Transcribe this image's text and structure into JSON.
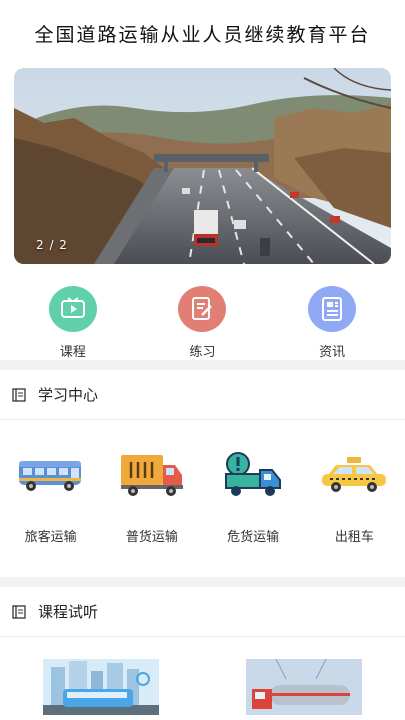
{
  "header": {
    "title": "全国道路运输从业人员继续教育平台"
  },
  "banner": {
    "counter": "2 / 2"
  },
  "quick_nav": [
    {
      "label": "课程",
      "icon": "tv-play-icon",
      "color": "#5fd0a7"
    },
    {
      "label": "练习",
      "icon": "edit-note-icon",
      "color": "#e27f74"
    },
    {
      "label": "资讯",
      "icon": "newspaper-icon",
      "color": "#8fa9f5"
    }
  ],
  "study_center": {
    "title": "学习中心",
    "icon": "book-icon",
    "items": [
      {
        "label": "旅客运输",
        "icon": "bus-icon"
      },
      {
        "label": "普货运输",
        "icon": "cargo-truck-icon"
      },
      {
        "label": "危货运输",
        "icon": "hazard-truck-icon"
      },
      {
        "label": "出租车",
        "icon": "taxi-icon"
      }
    ]
  },
  "course_trial": {
    "title": "课程试听",
    "icon": "book-icon"
  }
}
